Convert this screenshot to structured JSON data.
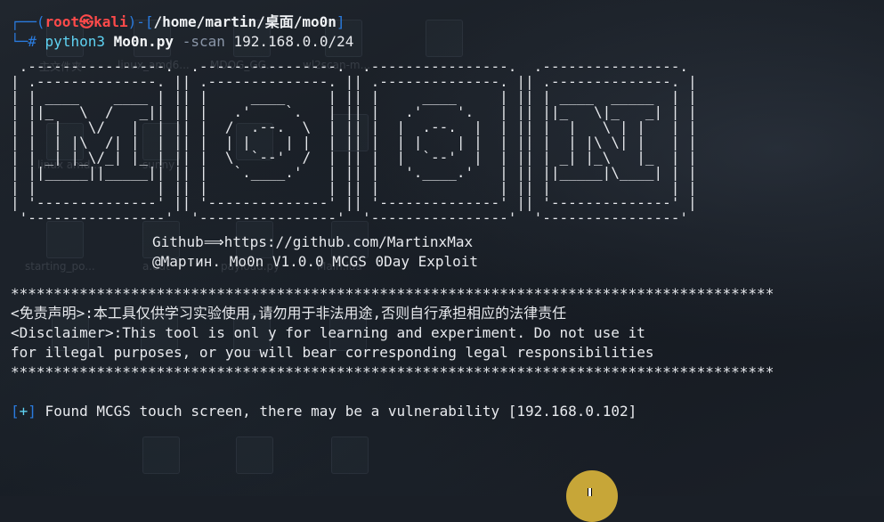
{
  "prompt": {
    "open_bracket": "┌──(",
    "user": "root㉿kali",
    "mid": ")-[",
    "path": "/home/martin/桌面/mo0n",
    "close_bracket": "]",
    "hash_line": "└─#",
    "command": "python3",
    "script": "Mo0n.py",
    "flag": "-scan",
    "target": "192.168.0.0/24"
  },
  "banner": {
    "ascii_art": " .----------------.  .----------------.  .----------------.  .----------------.\n| .--------------. || .--------------. || .--------------. || .--------------. |\n| | ____    ____ | || |     ____     | || |     ____     | || | ____  _____  | |\n| ||_   \\  /   _|| || |   .'    `.   | || |   .'    '.   | || ||_   \\|_   _| | |\n| |  |   \\/   |  | || |  /  .--.  \\  | || |  |  .--.  |  | || |  |   \\ | |   | |\n| |  | |\\  /| |  | || |  | |    | |  | || |  | |    | |  | || |  | |\\ \\| |   | |\n| | _| |_\\/_| |_ | || |  \\  `--'  /  | || |  |  `--'  |  | || | _| |_\\   |_  | |\n| ||_____||_____|| || |   `.____.'   | || |   '.____.'   | || ||_____|\\____| | |\n| |              | || |              | || |              | || |              | |\n| '--------------' || '--------------' || '--------------' || '--------------' |\n '----------------'  '----------------'  '----------------'  '----------------'",
    "github_line": "Github⟹https://github.com/MartinxMax",
    "author_line": "@Мартин. Mo0n V1.0.0 MCGS 0Day Exploit"
  },
  "disclaimer": {
    "stars": "*****************************************************************************************",
    "zh": "<免责声明>:本工具仅供学习实验使用,请勿用于非法用途,否则自行承担相应的法律责任",
    "en_line1": "<Disclaimer>:This tool is onl y for learning and experiment. Do not use it",
    "en_line2": "for illegal purposes, or you will bear corresponding legal responsibilities"
  },
  "result": {
    "bracket_open": "[",
    "plus": "+",
    "bracket_close": "]",
    "message": " Found MCGS touch screen, there may be a vulnerability [192.168.0.102]"
  },
  "desktop_labels": [
    "主文件夹",
    "linux_amd6...",
    "MDOG_GG...",
    "wl2scan-m...",
    "starting_po...",
    "a.odt",
    "payload.py",
    "Main.lua",
    "linux amd...",
    "sunny"
  ],
  "colors": {
    "background": "#1a1f27",
    "prompt_bracket": "#2a7bde",
    "user": "#ff4a4a",
    "command": "#5fd3f3"
  }
}
